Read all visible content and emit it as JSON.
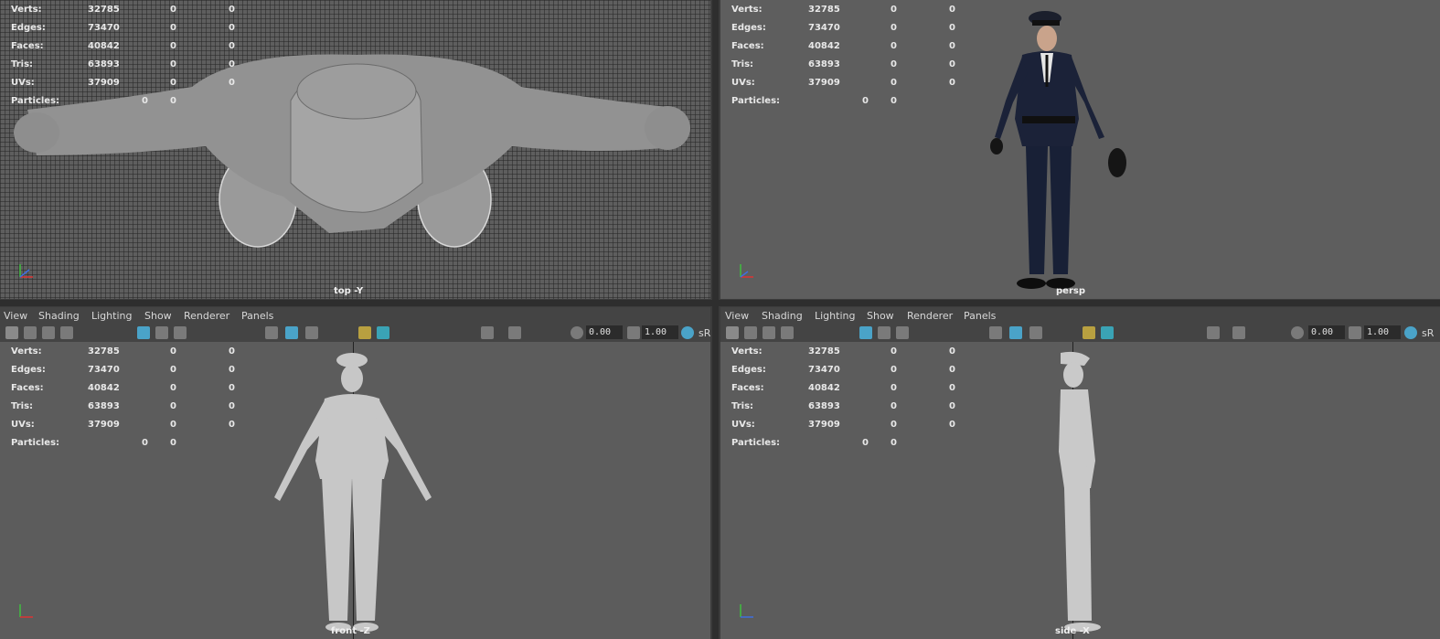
{
  "hud": {
    "rows": [
      {
        "label": "Verts:",
        "v1": "32785",
        "v2": "0",
        "v3": "0"
      },
      {
        "label": "Edges:",
        "v1": "73470",
        "v2": "0",
        "v3": "0"
      },
      {
        "label": "Faces:",
        "v1": "40842",
        "v2": "0",
        "v3": "0"
      },
      {
        "label": "Tris:",
        "v1": "63893",
        "v2": "0",
        "v3": "0"
      },
      {
        "label": "UVs:",
        "v1": "37909",
        "v2": "0",
        "v3": "0"
      }
    ],
    "particles": {
      "label": "Particles:",
      "v1": "0",
      "v2": "0"
    }
  },
  "viewports": {
    "top": {
      "camera": "top -Y"
    },
    "persp": {
      "camera": "persp"
    },
    "front": {
      "camera": "front -Z"
    },
    "side": {
      "camera": "side -X"
    }
  },
  "panel_menu": {
    "view": "View",
    "shading": "Shading",
    "lighting": "Lighting",
    "show": "Show",
    "renderer": "Renderer",
    "panels": "Panels"
  },
  "panel_toolbar": {
    "exposure": "0.00",
    "gamma": "1.00",
    "colorspace": "sR"
  },
  "icons": [
    "camera-icon",
    "grid-icon",
    "wireframe-icon",
    "smooth-shade-icon",
    "lights-icon",
    "isolate-icon",
    "exposure-icon",
    "gamma-icon",
    "color-management-icon"
  ],
  "colors": {
    "viewport": "#5c5c5c",
    "panel": "#444444",
    "active_icon": "#4aa3c8",
    "field": "#2b2b2b"
  }
}
